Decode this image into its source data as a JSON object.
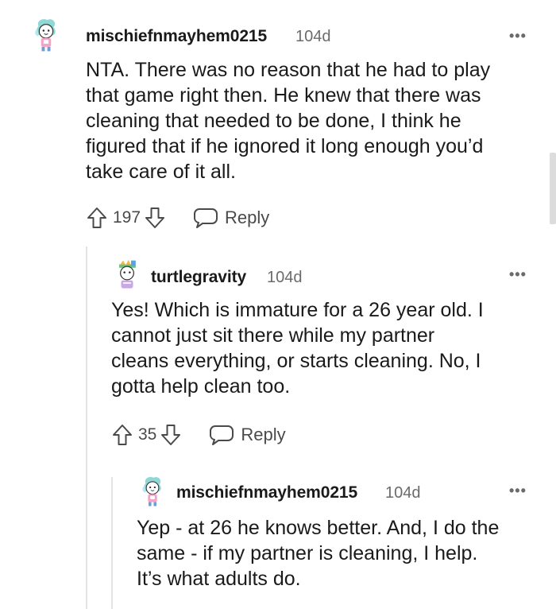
{
  "comments": [
    {
      "author": "mischiefnmayhem0215",
      "age": "104d",
      "more": "•••",
      "body": "NTA. There was no reason that he had to play\nthat game right then. He knew that there was\ncleaning that needed to be done, I think he\nfigured that if he ignored it long enough you’d\ntake care of it all.",
      "score": "197",
      "reply_label": "Reply"
    },
    {
      "author": "turtlegravity",
      "age": "104d",
      "more": "•••",
      "body": "Yes! Which is immature for a 26 year old. I\ncannot just sit there while my partner\ncleans everything, or starts cleaning. No, I\ngotta help clean too.",
      "score": "35",
      "reply_label": "Reply"
    },
    {
      "author": "mischiefnmayhem0215",
      "age": "104d",
      "more": "•••",
      "body": "Yep - at 26 he knows better. And, I do the\nsame - if my partner is cleaning, I help.\nIt’s what adults do."
    }
  ],
  "colors": {
    "text": "#1a1a1b",
    "meta": "#6b6b6b",
    "thread_line": "#e3e3e3"
  },
  "icons": [
    "upvote-arrow-icon",
    "downvote-arrow-icon",
    "speech-bubble-icon",
    "more-options-icon"
  ]
}
